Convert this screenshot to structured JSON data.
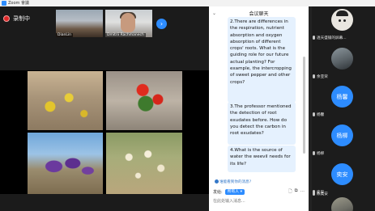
{
  "window": {
    "title": "Zoom 會議"
  },
  "recording": {
    "label": "录制中"
  },
  "thumbnails": [
    {
      "name": "DianLin"
    },
    {
      "name": "Dmitrii Rachmanech"
    }
  ],
  "chat": {
    "title": "会议聊天",
    "messages": [
      {
        "text": "2.There are differences in the respiration, nutrient absorption and oxygen absorption of different crops' roots. What is the guiding role for our future actual planting? For example, the intercropping of sweet pepper and other crops?"
      },
      {
        "text": "3.The professor mentioned the detection of root exudates before. How do you detect  the carbon in root exudates?"
      },
      {
        "text": "4.What is the source of water the weevil needs for its life?"
      }
    ],
    "notice": "谁能看到你的消息?",
    "send_to_label": "发给:",
    "send_to_value": "所有人",
    "input_placeholder": "在此处输入消息..."
  },
  "gallery": [
    {
      "name": "透天盛铺的屏幕...",
      "type": "cartoon"
    },
    {
      "name": "余亚荣",
      "type": "photo"
    },
    {
      "name": "杨馨",
      "type": "text",
      "avatar_text": "杨馨"
    },
    {
      "name": "杨柳",
      "type": "text",
      "avatar_text": "杨柳"
    },
    {
      "name": "奕安",
      "type": "text",
      "avatar_text": "奕安"
    },
    {
      "name": "陈奕安",
      "type": "photo"
    }
  ],
  "colors": {
    "accent": "#2d8cff",
    "record": "#e02828",
    "bubble": "#e5f1fe"
  }
}
